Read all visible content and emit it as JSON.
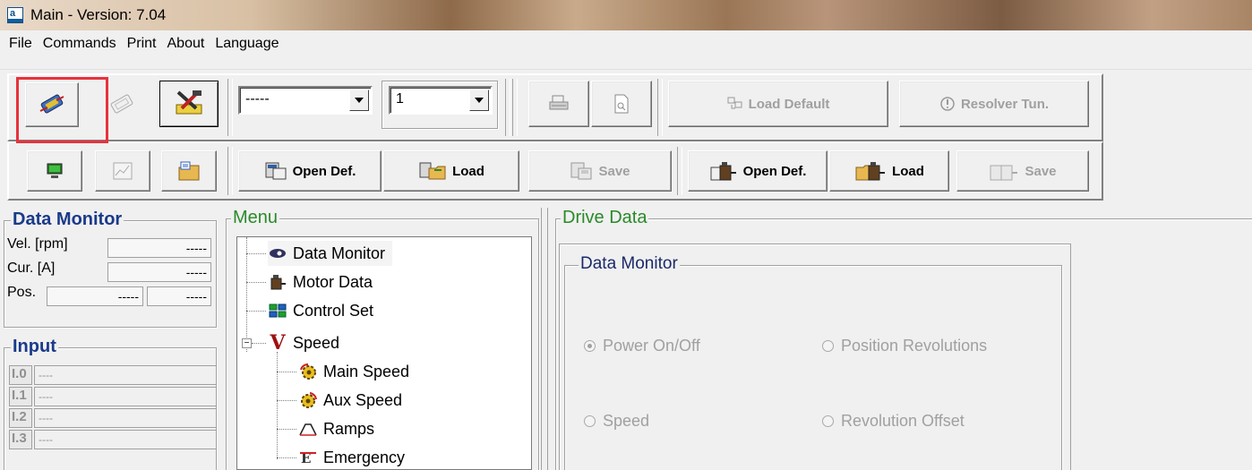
{
  "window": {
    "title": "Main - Version: 7.04",
    "app_icon_letter": "a"
  },
  "menubar": [
    "File",
    "Commands",
    "Print",
    "About",
    "Language"
  ],
  "toolbar1": {
    "combo1_value": "-----",
    "combo2_value": "1",
    "load_default_label": "Load Default",
    "resolver_label": "Resolver Tun."
  },
  "toolbar2": {
    "open_def_1": "Open Def.",
    "load_1": "Load",
    "save_1": "Save",
    "open_def_2": "Open Def.",
    "load_2": "Load",
    "save_2": "Save"
  },
  "data_monitor": {
    "title": "Data Monitor",
    "rows": [
      {
        "label": "Vel. [rpm]",
        "value": "-----"
      },
      {
        "label": "Cur. [A]",
        "value": "-----"
      },
      {
        "label": "Pos.",
        "value1": "-----",
        "value2": "-----"
      }
    ]
  },
  "input": {
    "title": "Input",
    "rows": [
      {
        "key": "I.0",
        "value": "----"
      },
      {
        "key": "I.1",
        "value": "----"
      },
      {
        "key": "I.2",
        "value": "----"
      },
      {
        "key": "I.3",
        "value": "----"
      }
    ]
  },
  "menu": {
    "title": "Menu",
    "items": [
      {
        "label": "Data Monitor",
        "icon": "eye-icon"
      },
      {
        "label": "Motor Data",
        "icon": "motor-icon"
      },
      {
        "label": "Control Set",
        "icon": "control-icon"
      },
      {
        "label": "Speed",
        "icon": "speed-v-icon"
      },
      {
        "label": "Main Speed",
        "icon": "gear-icon"
      },
      {
        "label": "Aux Speed",
        "icon": "gear-icon"
      },
      {
        "label": "Ramps",
        "icon": "ramp-icon"
      },
      {
        "label": "Emergency",
        "icon": "emergency-icon"
      }
    ]
  },
  "drive_data": {
    "title": "Drive Data",
    "subpanel_title": "Data Monitor",
    "options": [
      {
        "label": "Power On/Off",
        "checked": true
      },
      {
        "label": "Position Revolutions",
        "checked": false
      },
      {
        "label": "Speed",
        "checked": false
      },
      {
        "label": "Revolution Offset",
        "checked": false
      }
    ]
  },
  "colors": {
    "frame_title": "#1a3a8a",
    "menu_title": "#2a8a2a",
    "highlight": "#e8323c"
  }
}
